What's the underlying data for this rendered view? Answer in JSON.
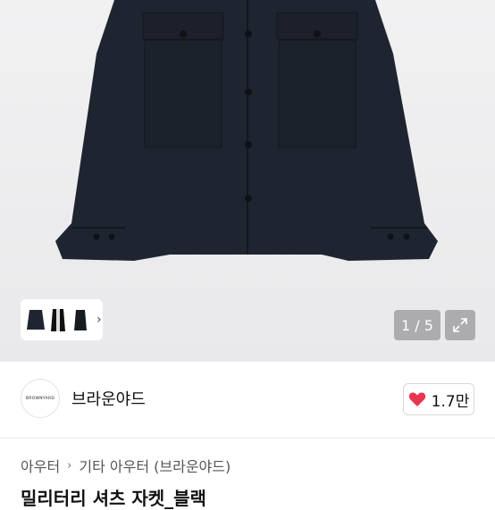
{
  "gallery": {
    "counter": "1 / 5",
    "thumbnails": [
      "jacket-front-thumb",
      "jacket-open-thumb",
      "jacket-side-thumb"
    ]
  },
  "seller": {
    "logo_text": "BROWNYARD",
    "name": "브라운야드",
    "likes": "1.7만"
  },
  "breadcrumb": {
    "level1": "아우터",
    "level2": "기타 아우터 (브라운야드)"
  },
  "product": {
    "title_partial": "밀리터리 셔츠 자켓_블랙"
  },
  "colors": {
    "heart": "#e8344e",
    "jacket": "#1f2530"
  }
}
